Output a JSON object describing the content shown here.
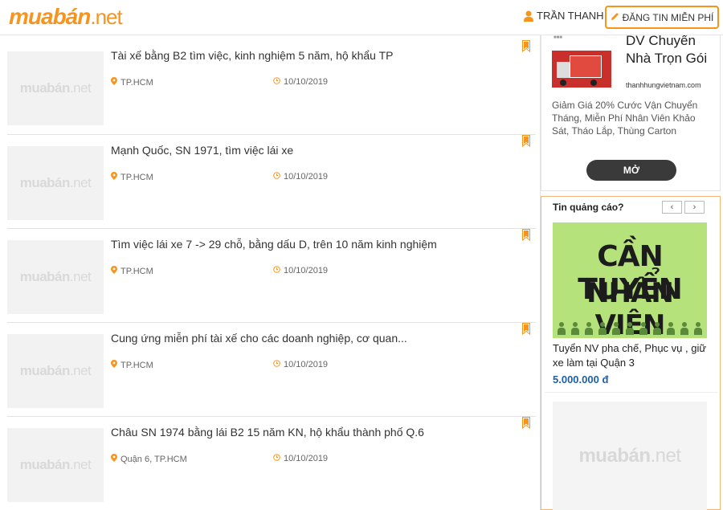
{
  "header": {
    "logo_brand": "muabán",
    "logo_tld": ".net",
    "user_name": "TRẦN THANH",
    "post_button": "ĐĂNG TIN MIỄN PHÍ"
  },
  "listings": [
    {
      "title": "Tài xế bằng B2 tìm việc, kinh nghiệm 5 năm, hộ khẩu TP",
      "location": "TP.HCM",
      "date": "10/10/2019"
    },
    {
      "title": "Mạnh Quốc, SN 1971, tìm việc lái xe",
      "location": "TP.HCM",
      "date": "10/10/2019"
    },
    {
      "title": "Tìm việc lái xe 7 -> 29 chỗ, bằng dấu D, trên 10 năm kinh nghiệm",
      "location": "TP.HCM",
      "date": "10/10/2019"
    },
    {
      "title": "Cung ứng miễn phí tài xế cho các doanh nghiệp, cơ quan...",
      "location": "TP.HCM",
      "date": "10/10/2019"
    },
    {
      "title": "Châu SN 1974 bằng lái B2 15 năm KN, hộ khẩu thành phố Q.6",
      "location": "Quận 6, TP.HCM",
      "date": "10/10/2019"
    }
  ],
  "thumbnail_watermark": {
    "brand": "muabán",
    "tld": ".net"
  },
  "sidebar": {
    "ad1": {
      "title": "DV Chuyển Nhà Trọn Gói",
      "site": "thanhhungvietnam.com",
      "description": "Giảm Giá 20% Cước Vận Chuyển Tháng, Miễn Phí Nhân Viên Khảo Sát, Tháo Lắp, Thùng Carton",
      "button": "MỞ"
    },
    "ad2": {
      "heading": "Tin quảng cáo?",
      "prev": "‹",
      "next": "›",
      "banner_line1": "CẦN TUYỂN",
      "banner_line2": "NHÂN VIÊN",
      "text": "Tuyển NV pha chế, Phục vụ , giữ xe làm tại Quận 3",
      "price": "5.000.000 đ"
    }
  },
  "colors": {
    "brand": "#f7941d",
    "price": "#1f5fa8",
    "bookmark": "#f7941d"
  }
}
